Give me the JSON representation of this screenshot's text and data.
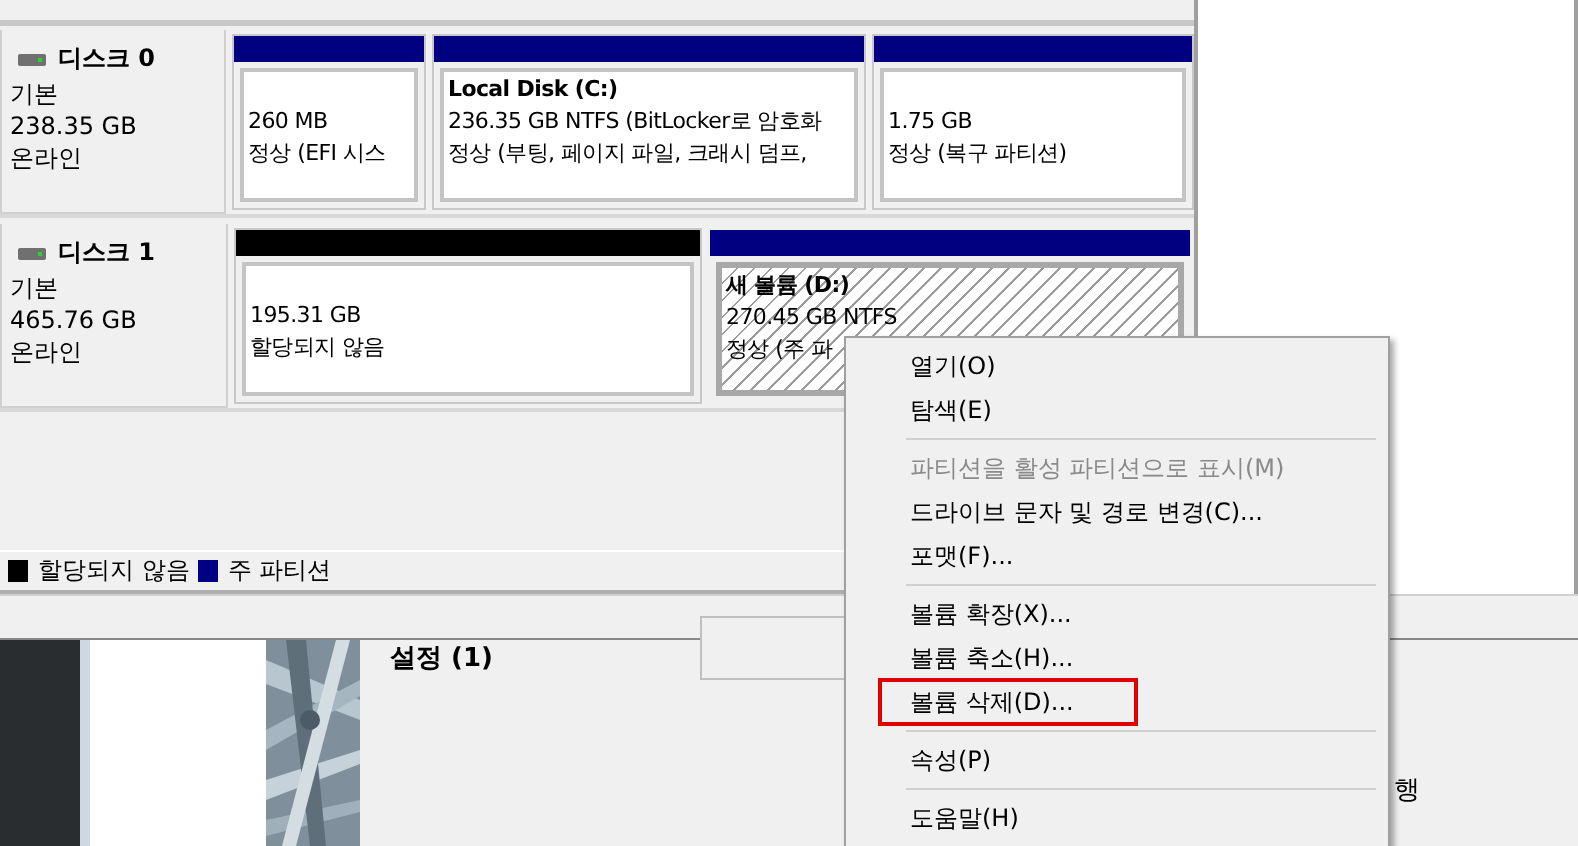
{
  "disks": [
    {
      "name": "디스크 0",
      "type": "기본",
      "size": "238.35 GB",
      "status": "온라인",
      "partitions": [
        {
          "kind": "primary",
          "size": "260 MB",
          "status": "정상 (EFI 시스",
          "selected": false
        },
        {
          "kind": "primary",
          "title": "Local Disk  (C:)",
          "size": "236.35 GB NTFS (BitLocker로 암호화",
          "status": "정상 (부팅, 페이지 파일, 크래시 덤프,",
          "selected": false
        },
        {
          "kind": "primary",
          "size": "1.75 GB",
          "status": "정상 (복구 파티션)",
          "selected": false
        }
      ]
    },
    {
      "name": "디스크 1",
      "type": "기본",
      "size": "465.76 GB",
      "status": "온라인",
      "partitions": [
        {
          "kind": "unallocated",
          "size": "195.31 GB",
          "status": "할당되지 않음",
          "selected": false
        },
        {
          "kind": "primary",
          "title": "새 볼륨  (D:)",
          "size": "270.45 GB NTFS",
          "status": "정상 (주 파",
          "selected": true
        }
      ]
    }
  ],
  "legend": [
    {
      "label": "할당되지 않음",
      "color": "#000000"
    },
    {
      "label": "주 파티션",
      "color": "#000080"
    }
  ],
  "background": {
    "heading": "설정 (1)",
    "fragment": "행"
  },
  "context_menu": {
    "items": [
      {
        "kind": "item",
        "label": "열기(O)",
        "disabled": false,
        "highlighted": false
      },
      {
        "kind": "item",
        "label": "탐색(E)",
        "disabled": false,
        "highlighted": false
      },
      {
        "kind": "separator"
      },
      {
        "kind": "item",
        "label": "파티션을 활성 파티션으로 표시(M)",
        "disabled": true,
        "highlighted": false
      },
      {
        "kind": "item",
        "label": "드라이브 문자 및 경로 변경(C)...",
        "disabled": false,
        "highlighted": false
      },
      {
        "kind": "item",
        "label": "포맷(F)...",
        "disabled": false,
        "highlighted": false
      },
      {
        "kind": "separator"
      },
      {
        "kind": "item",
        "label": "볼륨 확장(X)...",
        "disabled": false,
        "highlighted": false
      },
      {
        "kind": "item",
        "label": "볼륨 축소(H)...",
        "disabled": false,
        "highlighted": false
      },
      {
        "kind": "item",
        "label": "볼륨 삭제(D)...",
        "disabled": false,
        "highlighted": true
      },
      {
        "kind": "separator"
      },
      {
        "kind": "item",
        "label": "속성(P)",
        "disabled": false,
        "highlighted": false
      },
      {
        "kind": "separator"
      },
      {
        "kind": "item",
        "label": "도움말(H)",
        "disabled": false,
        "highlighted": false
      }
    ]
  }
}
